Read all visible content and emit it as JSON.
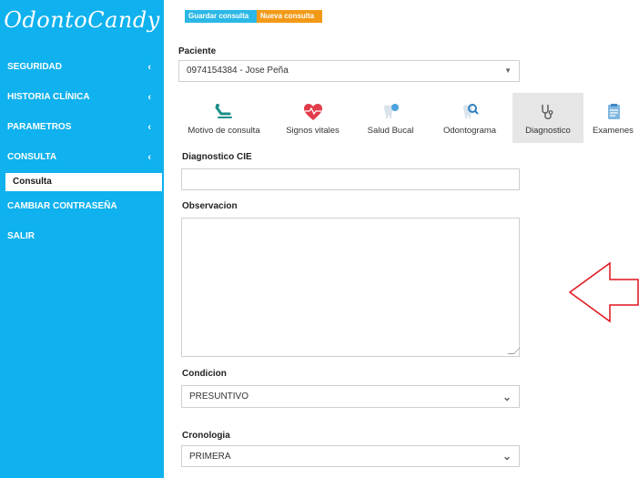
{
  "app": {
    "logo": "OdontoCandy"
  },
  "sidebar": {
    "items": [
      {
        "label": "SEGURIDAD",
        "chevron": "‹"
      },
      {
        "label": "HISTORIA CLÍNICA",
        "chevron": "‹"
      },
      {
        "label": "PARAMETROS",
        "chevron": "‹"
      },
      {
        "label": "CONSULTA",
        "chevron": "‹"
      }
    ],
    "sub_active": "Consulta",
    "items_after": [
      {
        "label": "CAMBIAR CONTRASEÑA"
      },
      {
        "label": "SALIR"
      }
    ]
  },
  "toolbar": {
    "save_label": "Guardar consulta",
    "new_label": "Nueva consulta"
  },
  "form": {
    "patient_label": "Paciente",
    "patient_value": "0974154384 - Jose Peña",
    "diagnosis_label": "Diagnostico CIE",
    "diagnosis_value": "",
    "observation_label": "Observacion",
    "observation_value": "",
    "condition_label": "Condicion",
    "condition_value": "PRESUNTIVO",
    "chronology_label": "Cronologia",
    "chronology_value": "PRIMERA"
  },
  "tabs": [
    {
      "label": "Motivo de consulta",
      "icon": "dental-chair-icon"
    },
    {
      "label": "Signos vitales",
      "icon": "heart-pulse-icon"
    },
    {
      "label": "Salud Bucal",
      "icon": "tooth-sparkle-icon"
    },
    {
      "label": "Odontograma",
      "icon": "tooth-search-icon"
    },
    {
      "label": "Diagnostico",
      "icon": "stethoscope-icon"
    },
    {
      "label": "Examenes",
      "icon": "clipboard-icon"
    }
  ],
  "colors": {
    "sidebar": "#0fb1ee",
    "save_button": "#2bb8e6",
    "new_button": "#f29a18",
    "annotation_arrow": "#e0141e"
  }
}
